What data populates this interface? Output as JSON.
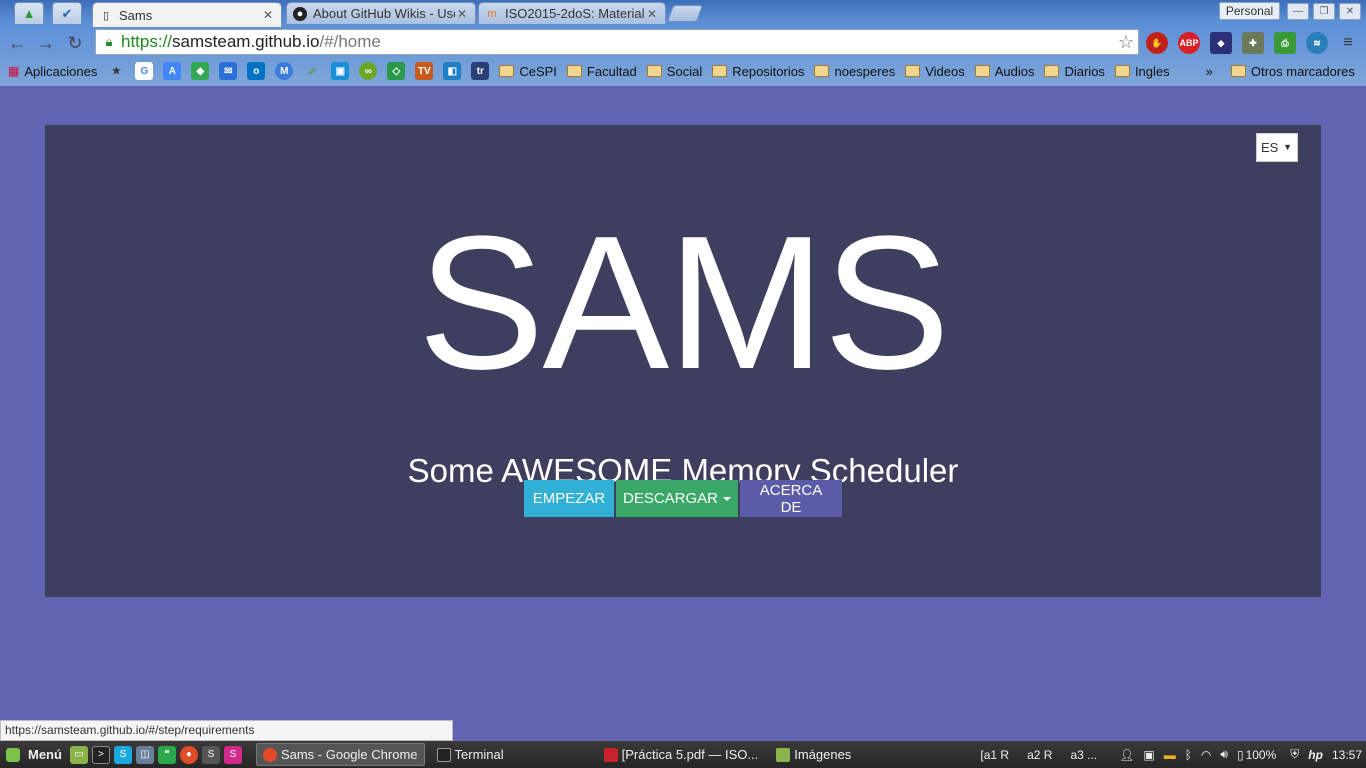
{
  "browser": {
    "tabs": [
      {
        "title": "Sams",
        "active": true
      },
      {
        "title": "About GitHub Wikis - Use",
        "active": false
      },
      {
        "title": "ISO2015-2doS: Material",
        "active": false
      }
    ],
    "profile_label": "Personal",
    "url": {
      "scheme": "https://",
      "host": "samsteam.github.io",
      "path": "/#/home"
    },
    "extensions": [
      "stop-icon",
      "adblock-icon",
      "wappalyzer-icon",
      "puzzle-icon",
      "print-icon",
      "wifi-icon",
      "menu-icon"
    ],
    "bookmarks": {
      "apps_label": "Aplicaciones",
      "folders": [
        "CeSPI",
        "Facultad",
        "Social",
        "Repositorios",
        "noesperes",
        "Videos",
        "Audios",
        "Diarios",
        "Ingles"
      ],
      "overflow": "»",
      "other_label": "Otros marcadores"
    },
    "status_url": "https://samsteam.github.io/#/step/requirements"
  },
  "page": {
    "lang": "ES",
    "title": "SAMS",
    "subtitle": "Some AWESOME Memory Scheduler",
    "buttons": {
      "start": "EMPEZAR",
      "download": "DESCARGAR",
      "about": "ACERCA DE"
    },
    "colors": {
      "background": "#6263b1",
      "hero": "#3e3e5e",
      "start": "#31b0d5",
      "download": "#3aa867",
      "about": "#5b5ba8"
    }
  },
  "taskbar": {
    "menu_label": "Menú",
    "windows": [
      {
        "title": "Sams - Google Chrome",
        "active": true
      },
      {
        "title": "Terminal",
        "active": false
      },
      {
        "title": "[Práctica 5.pdf — ISO...",
        "active": false
      },
      {
        "title": "Imágenes",
        "active": false
      }
    ],
    "workspaces": [
      "[a1 R",
      "a2 R",
      "a3 ..."
    ],
    "battery": "100%",
    "clock": "13:57"
  }
}
